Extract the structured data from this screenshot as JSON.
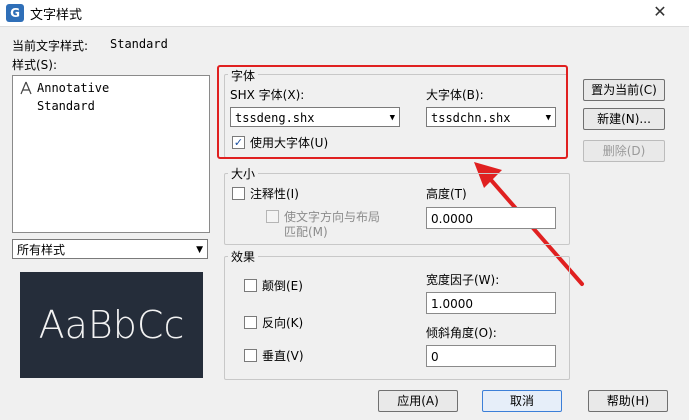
{
  "window": {
    "title": "文字样式",
    "app_icon": "G",
    "close_glyph": "✕"
  },
  "current_style": {
    "label": "当前文字样式:",
    "value": "Standard"
  },
  "styles": {
    "label": "样式(S):",
    "items": [
      "Annotative",
      "Standard"
    ]
  },
  "filter_combo": {
    "value": "所有样式"
  },
  "preview": {
    "text": "AaBbCc"
  },
  "font_group": {
    "label": "字体",
    "shx_label": "SHX 字体(X):",
    "shx_value": "tssdeng.shx",
    "bigfont_label": "大字体(B):",
    "bigfont_value": "tssdchn.shx",
    "use_bigfont_label": "使用大字体(U)",
    "use_bigfont_checked": true
  },
  "size_group": {
    "label": "大小",
    "annotative_label": "注释性(I)",
    "match_orientation_line1": "使文字方向与布局",
    "match_orientation_line2": "匹配(M)",
    "height_label": "高度(T)",
    "height_value": "0.0000"
  },
  "effects_group": {
    "label": "效果",
    "upside_down_label": "颠倒(E)",
    "backwards_label": "反向(K)",
    "vertical_label": "垂直(V)",
    "width_factor_label": "宽度因子(W):",
    "width_factor_value": "1.0000",
    "oblique_label": "倾斜角度(O):",
    "oblique_value": "0"
  },
  "buttons": {
    "set_current": "置为当前(C)",
    "new": "新建(N)...",
    "delete": "删除(D)",
    "apply": "应用(A)",
    "cancel": "取消",
    "help": "帮助(H)"
  },
  "annotation": {
    "color": "#e02020"
  }
}
